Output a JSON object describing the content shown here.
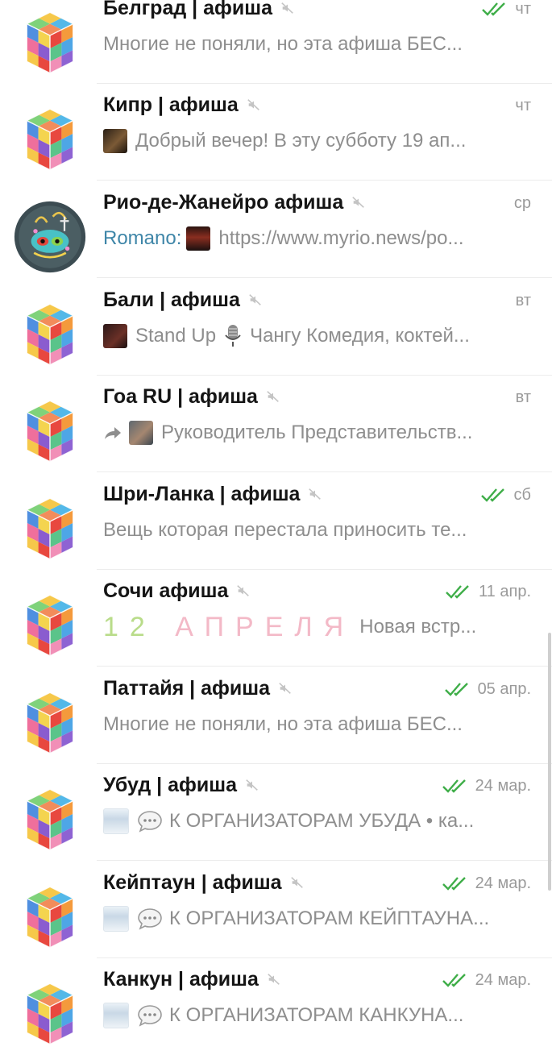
{
  "colors": {
    "check": "#3fae49",
    "sender": "#3f86a8",
    "name": "#151515",
    "preview": "#8e8e8e",
    "date": "#9a9a9a"
  },
  "chats": [
    {
      "name": "Белград | афиша",
      "muted": true,
      "read_ticks": true,
      "date": "чт",
      "avatar_icon": "rubiks-cube-icon",
      "preview": {
        "text": "Многие не поняли, но эта афиша БЕС..."
      }
    },
    {
      "name": "Кипр | афиша",
      "muted": true,
      "read_ticks": false,
      "date": "чт",
      "avatar_icon": "rubiks-cube-icon",
      "preview": {
        "thumbnail": "photo-thumbnail",
        "text": "Добрый вечер!  В эту субботу 19 ап..."
      }
    },
    {
      "name": "Рио-де-Жанейро афиша",
      "muted": true,
      "read_ticks": false,
      "date": "ср",
      "avatar_icon": "rio-carnival-mask-icon",
      "preview": {
        "sender": "Romano:",
        "thumbnail": "photo-thumbnail",
        "text": "https://www.myrio.news/po..."
      }
    },
    {
      "name": "Бали | афиша",
      "muted": true,
      "read_ticks": false,
      "date": "вт",
      "avatar_icon": "rubiks-cube-icon",
      "preview": {
        "thumbnail": "photo-thumbnail",
        "text_a": "Stand Up",
        "emoji": "microphone-icon",
        "text": "Чангу Комедия, коктей..."
      }
    },
    {
      "name": "Гоа RU | афиша",
      "muted": true,
      "read_ticks": false,
      "date": "вт",
      "avatar_icon": "rubiks-cube-icon",
      "preview": {
        "forward": "forward-arrow-icon",
        "thumbnail": "photo-thumbnail",
        "text": "Руководитель Представительств..."
      }
    },
    {
      "name": "Шри-Ланка | афиша",
      "muted": true,
      "read_ticks": true,
      "date": "сб",
      "avatar_icon": "rubiks-cube-icon",
      "preview": {
        "text": "Вещь которая перестала приносить те..."
      }
    },
    {
      "name": "Сочи афиша",
      "muted": true,
      "read_ticks": true,
      "date": "11 апр.",
      "avatar_icon": "rubiks-cube-icon",
      "preview": {
        "big_a": "12",
        "big_b": "АПРЕЛЯ",
        "text": "Новая встр..."
      }
    },
    {
      "name": "Паттайя | афиша",
      "muted": true,
      "read_ticks": true,
      "date": "05 апр.",
      "avatar_icon": "rubiks-cube-icon",
      "preview": {
        "text": "Многие не поняли, но эта афиша БЕС..."
      }
    },
    {
      "name": "Убуд | афиша",
      "muted": true,
      "read_ticks": true,
      "date": "24 мар.",
      "avatar_icon": "rubiks-cube-icon",
      "preview": {
        "thumbnail": "photo-thumbnail",
        "emoji": "speech-bubble-icon",
        "text": "К ОРГАНИЗАТОРАМ УБУДА  •  ка..."
      }
    },
    {
      "name": "Кейптаун | афиша",
      "muted": true,
      "read_ticks": true,
      "date": "24 мар.",
      "avatar_icon": "rubiks-cube-icon",
      "preview": {
        "thumbnail": "photo-thumbnail",
        "emoji": "speech-bubble-icon",
        "text": "К ОРГАНИЗАТОРАМ КЕЙПТАУНА..."
      }
    },
    {
      "name": "Канкун | афиша",
      "muted": true,
      "read_ticks": true,
      "date": "24 мар.",
      "avatar_icon": "rubiks-cube-icon",
      "preview": {
        "thumbnail": "photo-thumbnail",
        "emoji": "speech-bubble-icon",
        "text": "К ОРГАНИЗАТОРАМ КАНКУНА..."
      }
    }
  ]
}
